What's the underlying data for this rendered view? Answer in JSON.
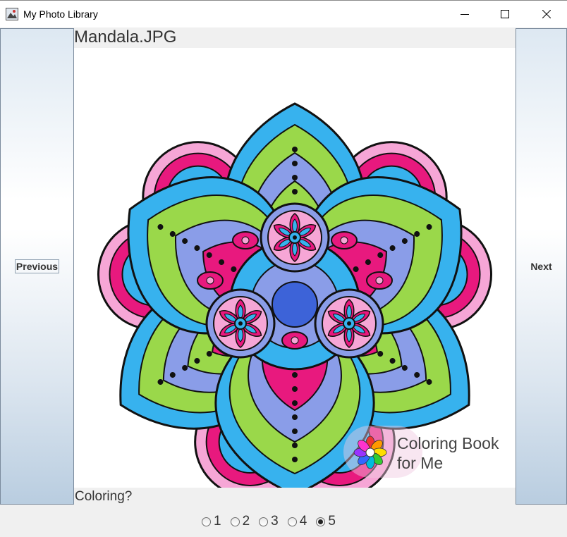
{
  "window": {
    "title": "My Photo Library",
    "icon": "photo-app-icon",
    "controls": [
      "minimize-icon",
      "maximize-icon",
      "close-icon"
    ]
  },
  "nav": {
    "previous_label": "Previous",
    "next_label": "Next"
  },
  "photo": {
    "filename": "Mandala.JPG",
    "subject": "mandala-coloring-image",
    "watermark_text": "Coloring Book\nfor Me",
    "colors": {
      "pink": "#e8197e",
      "light_pink": "#f6a6d6",
      "blue": "#37b2ee",
      "periwinkle": "#8a9de8",
      "royal": "#3d63d8",
      "green": "#9ad84a",
      "outline": "#111111"
    }
  },
  "question": "Coloring?",
  "rating": {
    "options": [
      "1",
      "2",
      "3",
      "4",
      "5"
    ],
    "selected": "5"
  }
}
